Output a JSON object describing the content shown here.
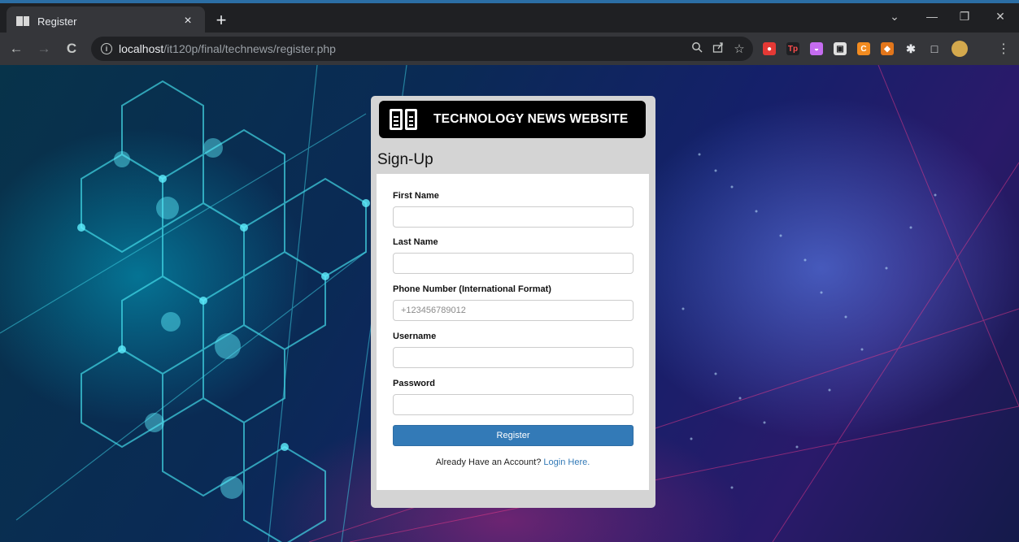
{
  "browser": {
    "tab_title": "Register",
    "tab_close": "×",
    "new_tab": "+",
    "window_controls": [
      "⌄",
      "—",
      "❐",
      "✕"
    ],
    "nav": {
      "back": "←",
      "forward": "→",
      "reload": "C"
    },
    "url_host": "localhost",
    "url_path": "/it120p/final/technews/register.php",
    "omnibox_icons": [
      "zoom-icon",
      "share-icon",
      "bookmark-star-icon"
    ],
    "extensions": [
      {
        "name": "ext-red-icon",
        "color": "#e53935",
        "glyph": "●"
      },
      {
        "name": "ext-tp-icon",
        "color": "#1f2023",
        "glyph": "Tp"
      },
      {
        "name": "ext-pocket-icon",
        "color": "#c56cf0",
        "glyph": "◒"
      },
      {
        "name": "ext-box-icon",
        "color": "#e0e0e0",
        "glyph": "▣"
      },
      {
        "name": "ext-c-icon",
        "color": "#f28b20",
        "glyph": "C"
      },
      {
        "name": "ext-fox-icon",
        "color": "#e2761b",
        "glyph": "◆"
      },
      {
        "name": "extensions-puzzle-icon",
        "color": "#35363a",
        "glyph": "✱"
      },
      {
        "name": "sidepanel-icon",
        "color": "#35363a",
        "glyph": "□"
      },
      {
        "name": "profile-avatar-icon",
        "color": "#d4a94d",
        "glyph": ""
      }
    ],
    "menu": "⋮"
  },
  "card": {
    "banner_title": "TECHNOLOGY NEWS WEBSITE",
    "heading": "Sign-Up",
    "fields": {
      "first_name": {
        "label": "First Name",
        "value": "",
        "placeholder": ""
      },
      "last_name": {
        "label": "Last Name",
        "value": "",
        "placeholder": ""
      },
      "phone": {
        "label": "Phone Number (International Format)",
        "value": "",
        "placeholder": "+123456789012"
      },
      "username": {
        "label": "Username",
        "value": "",
        "placeholder": ""
      },
      "password": {
        "label": "Password",
        "value": "",
        "placeholder": ""
      }
    },
    "register_label": "Register",
    "login_prompt": "Already Have an Account?",
    "login_link": "Login Here."
  },
  "colors": {
    "accent": "#337ab7",
    "banner_bg": "#000000",
    "card_bg": "#d4d4d4"
  }
}
